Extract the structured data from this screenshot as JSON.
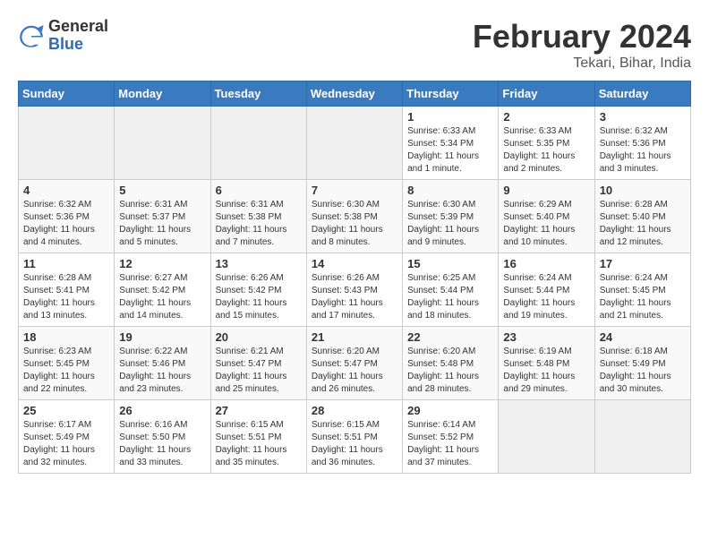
{
  "logo": {
    "general": "General",
    "blue": "Blue"
  },
  "title": "February 2024",
  "location": "Tekari, Bihar, India",
  "days_of_week": [
    "Sunday",
    "Monday",
    "Tuesday",
    "Wednesday",
    "Thursday",
    "Friday",
    "Saturday"
  ],
  "weeks": [
    [
      {
        "day": "",
        "info": ""
      },
      {
        "day": "",
        "info": ""
      },
      {
        "day": "",
        "info": ""
      },
      {
        "day": "",
        "info": ""
      },
      {
        "day": "1",
        "info": "Sunrise: 6:33 AM\nSunset: 5:34 PM\nDaylight: 11 hours and 1 minute."
      },
      {
        "day": "2",
        "info": "Sunrise: 6:33 AM\nSunset: 5:35 PM\nDaylight: 11 hours and 2 minutes."
      },
      {
        "day": "3",
        "info": "Sunrise: 6:32 AM\nSunset: 5:36 PM\nDaylight: 11 hours and 3 minutes."
      }
    ],
    [
      {
        "day": "4",
        "info": "Sunrise: 6:32 AM\nSunset: 5:36 PM\nDaylight: 11 hours and 4 minutes."
      },
      {
        "day": "5",
        "info": "Sunrise: 6:31 AM\nSunset: 5:37 PM\nDaylight: 11 hours and 5 minutes."
      },
      {
        "day": "6",
        "info": "Sunrise: 6:31 AM\nSunset: 5:38 PM\nDaylight: 11 hours and 7 minutes."
      },
      {
        "day": "7",
        "info": "Sunrise: 6:30 AM\nSunset: 5:38 PM\nDaylight: 11 hours and 8 minutes."
      },
      {
        "day": "8",
        "info": "Sunrise: 6:30 AM\nSunset: 5:39 PM\nDaylight: 11 hours and 9 minutes."
      },
      {
        "day": "9",
        "info": "Sunrise: 6:29 AM\nSunset: 5:40 PM\nDaylight: 11 hours and 10 minutes."
      },
      {
        "day": "10",
        "info": "Sunrise: 6:28 AM\nSunset: 5:40 PM\nDaylight: 11 hours and 12 minutes."
      }
    ],
    [
      {
        "day": "11",
        "info": "Sunrise: 6:28 AM\nSunset: 5:41 PM\nDaylight: 11 hours and 13 minutes."
      },
      {
        "day": "12",
        "info": "Sunrise: 6:27 AM\nSunset: 5:42 PM\nDaylight: 11 hours and 14 minutes."
      },
      {
        "day": "13",
        "info": "Sunrise: 6:26 AM\nSunset: 5:42 PM\nDaylight: 11 hours and 15 minutes."
      },
      {
        "day": "14",
        "info": "Sunrise: 6:26 AM\nSunset: 5:43 PM\nDaylight: 11 hours and 17 minutes."
      },
      {
        "day": "15",
        "info": "Sunrise: 6:25 AM\nSunset: 5:44 PM\nDaylight: 11 hours and 18 minutes."
      },
      {
        "day": "16",
        "info": "Sunrise: 6:24 AM\nSunset: 5:44 PM\nDaylight: 11 hours and 19 minutes."
      },
      {
        "day": "17",
        "info": "Sunrise: 6:24 AM\nSunset: 5:45 PM\nDaylight: 11 hours and 21 minutes."
      }
    ],
    [
      {
        "day": "18",
        "info": "Sunrise: 6:23 AM\nSunset: 5:45 PM\nDaylight: 11 hours and 22 minutes."
      },
      {
        "day": "19",
        "info": "Sunrise: 6:22 AM\nSunset: 5:46 PM\nDaylight: 11 hours and 23 minutes."
      },
      {
        "day": "20",
        "info": "Sunrise: 6:21 AM\nSunset: 5:47 PM\nDaylight: 11 hours and 25 minutes."
      },
      {
        "day": "21",
        "info": "Sunrise: 6:20 AM\nSunset: 5:47 PM\nDaylight: 11 hours and 26 minutes."
      },
      {
        "day": "22",
        "info": "Sunrise: 6:20 AM\nSunset: 5:48 PM\nDaylight: 11 hours and 28 minutes."
      },
      {
        "day": "23",
        "info": "Sunrise: 6:19 AM\nSunset: 5:48 PM\nDaylight: 11 hours and 29 minutes."
      },
      {
        "day": "24",
        "info": "Sunrise: 6:18 AM\nSunset: 5:49 PM\nDaylight: 11 hours and 30 minutes."
      }
    ],
    [
      {
        "day": "25",
        "info": "Sunrise: 6:17 AM\nSunset: 5:49 PM\nDaylight: 11 hours and 32 minutes."
      },
      {
        "day": "26",
        "info": "Sunrise: 6:16 AM\nSunset: 5:50 PM\nDaylight: 11 hours and 33 minutes."
      },
      {
        "day": "27",
        "info": "Sunrise: 6:15 AM\nSunset: 5:51 PM\nDaylight: 11 hours and 35 minutes."
      },
      {
        "day": "28",
        "info": "Sunrise: 6:15 AM\nSunset: 5:51 PM\nDaylight: 11 hours and 36 minutes."
      },
      {
        "day": "29",
        "info": "Sunrise: 6:14 AM\nSunset: 5:52 PM\nDaylight: 11 hours and 37 minutes."
      },
      {
        "day": "",
        "info": ""
      },
      {
        "day": "",
        "info": ""
      }
    ]
  ]
}
